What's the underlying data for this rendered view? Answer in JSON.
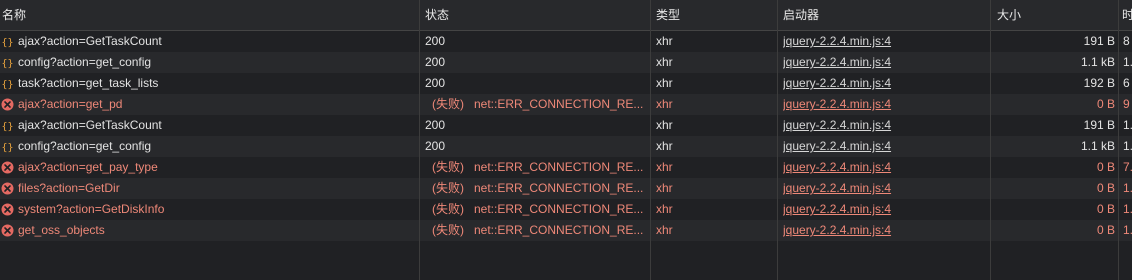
{
  "columns": {
    "name": "名称",
    "status": "状态",
    "type": "类型",
    "initiator": "启动器",
    "size": "大小",
    "time": "时"
  },
  "rows": [
    {
      "name": "ajax?action=GetTaskCount",
      "status": "200",
      "type": "xhr",
      "initiator": "jquery-2.2.4.min.js:4",
      "size": "191 B",
      "time": "8",
      "failed": false,
      "icon": "xhr-icon"
    },
    {
      "name": "config?action=get_config",
      "status": "200",
      "type": "xhr",
      "initiator": "jquery-2.2.4.min.js:4",
      "size": "1.1 kB",
      "time": "1.",
      "failed": false,
      "icon": "xhr-icon"
    },
    {
      "name": "task?action=get_task_lists",
      "status": "200",
      "type": "xhr",
      "initiator": "jquery-2.2.4.min.js:4",
      "size": "192 B",
      "time": "6",
      "failed": false,
      "icon": "xhr-icon"
    },
    {
      "name": "ajax?action=get_pd",
      "status": "(失败)",
      "status_detail": "net::ERR_CONNECTION_RE...",
      "type": "xhr",
      "initiator": "jquery-2.2.4.min.js:4",
      "size": "0 B",
      "time": "9",
      "failed": true,
      "icon": "error-icon"
    },
    {
      "name": "ajax?action=GetTaskCount",
      "status": "200",
      "type": "xhr",
      "initiator": "jquery-2.2.4.min.js:4",
      "size": "191 B",
      "time": "1.",
      "failed": false,
      "icon": "xhr-icon"
    },
    {
      "name": "config?action=get_config",
      "status": "200",
      "type": "xhr",
      "initiator": "jquery-2.2.4.min.js:4",
      "size": "1.1 kB",
      "time": "1.",
      "failed": false,
      "icon": "xhr-icon"
    },
    {
      "name": "ajax?action=get_pay_type",
      "status": "(失败)",
      "status_detail": "net::ERR_CONNECTION_RE...",
      "type": "xhr",
      "initiator": "jquery-2.2.4.min.js:4",
      "size": "0 B",
      "time": "7.",
      "failed": true,
      "icon": "error-icon"
    },
    {
      "name": "files?action=GetDir",
      "status": "(失败)",
      "status_detail": "net::ERR_CONNECTION_RE...",
      "type": "xhr",
      "initiator": "jquery-2.2.4.min.js:4",
      "size": "0 B",
      "time": "1.",
      "failed": true,
      "icon": "error-icon"
    },
    {
      "name": "system?action=GetDiskInfo",
      "status": "(失败)",
      "status_detail": "net::ERR_CONNECTION_RE...",
      "type": "xhr",
      "initiator": "jquery-2.2.4.min.js:4",
      "size": "0 B",
      "time": "1.",
      "failed": true,
      "icon": "error-icon"
    },
    {
      "name": "get_oss_objects",
      "status": "(失败)",
      "status_detail": "net::ERR_CONNECTION_RE...",
      "type": "xhr",
      "initiator": "jquery-2.2.4.min.js:4",
      "size": "0 B",
      "time": "1.",
      "failed": true,
      "icon": "error-icon"
    }
  ],
  "colors": {
    "background": "#202124",
    "row_alt": "#28292c",
    "error_text": "#ee8878",
    "error_icon": "#e46962",
    "xhr_icon": "#e8a33d"
  }
}
